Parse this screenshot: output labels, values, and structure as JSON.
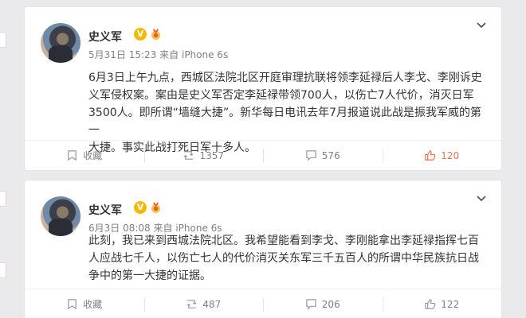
{
  "posts": [
    {
      "author": "史义军",
      "badge": "V",
      "time": "5月31日 15:23",
      "source_prefix": "来自",
      "source": "iPhone 6s",
      "text_lines": [
        "6月3日上午九点，西城区法院北区开庭审理抗联将领李延禄后人李戈、李刚诉史",
        "义军侵权案。案由是史义军否定李延禄带领700人，以伤亡7人代价，消灭日军",
        "3500人。即所谓“墙缝大捷”。新华每日电讯去年7月报道说此战是振我军威的第一",
        "大捷。事实此战打死日军十多人。"
      ],
      "actions": {
        "favorite": "收藏",
        "repost": "1357",
        "comment": "576",
        "like": "120"
      }
    },
    {
      "author": "史义军",
      "badge": "V",
      "time": "6月3日 08:08",
      "source_prefix": "来自",
      "source": "iPhone 6s",
      "text_lines": [
        "此刻，我已来到西城法院北区。我希望能看到李戈、李刚能拿出李延禄指挥七百",
        "人应战七千人，以伤亡七人的代价消灭关东军三千五百人的所谓中华民族抗日战",
        "争中的第一大捷的证据。"
      ],
      "actions": {
        "favorite": "收藏",
        "repost": "487",
        "comment": "206",
        "like": "122"
      }
    }
  ],
  "colors": {
    "background": "#eaeaec",
    "card": "#ffffff",
    "text": "#333333",
    "meta": "#808080",
    "badge": "#f6b800",
    "liked": "#eb7350"
  },
  "icons": [
    "avatar",
    "verified-badge",
    "medal-icon",
    "chevron-down-icon",
    "favorite-icon",
    "repost-icon",
    "comment-icon",
    "like-icon"
  ]
}
